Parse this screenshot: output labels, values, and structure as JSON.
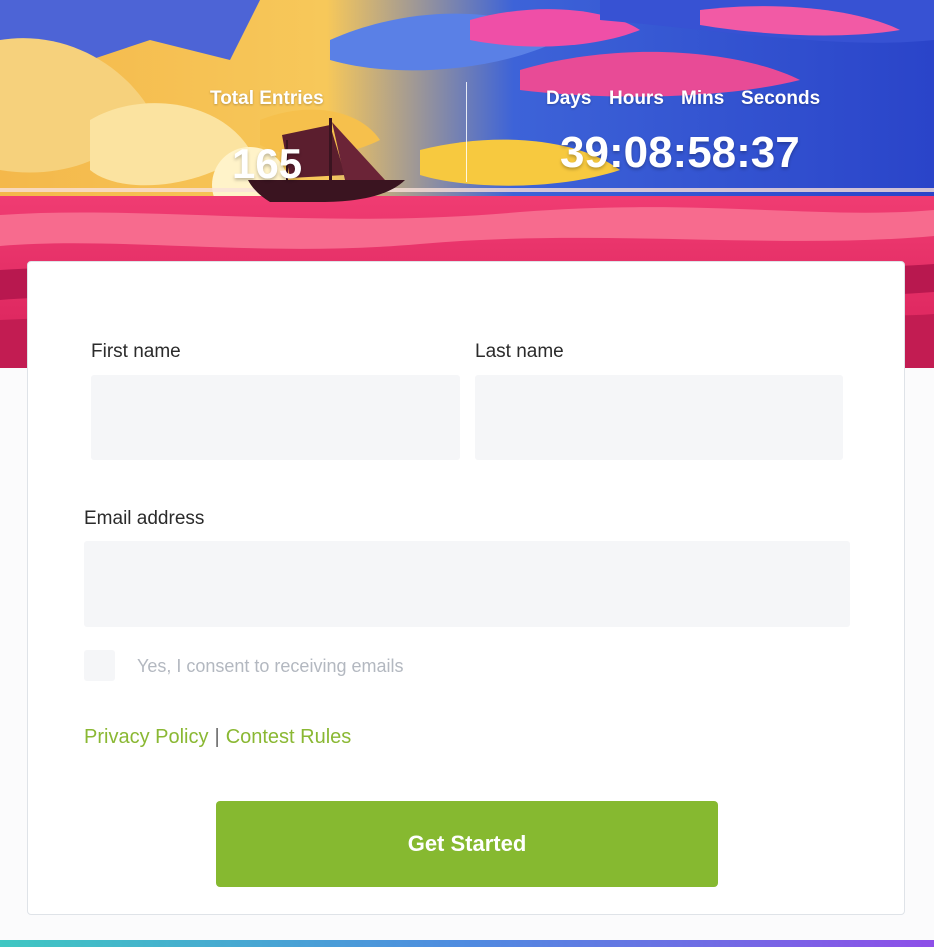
{
  "stats": {
    "entries_label": "Total Entries",
    "entries_value": "165"
  },
  "countdown": {
    "days_label": "Days",
    "hours_label": "Hours",
    "mins_label": "Mins",
    "seconds_label": "Seconds",
    "value": "39:08:58:37"
  },
  "form": {
    "first_name_label": "First name",
    "first_name_value": "",
    "last_name_label": "Last name",
    "last_name_value": "",
    "email_label": "Email address",
    "email_value": "",
    "consent_label": "Yes, I consent to receiving emails",
    "consent_checked": false
  },
  "links": {
    "privacy": "Privacy Policy",
    "separator": "|",
    "rules": "Contest Rules"
  },
  "cta": {
    "label": "Get Started"
  },
  "colors": {
    "accent": "#86b930",
    "link": "#8ab833",
    "input_bg": "#f5f6f8"
  }
}
